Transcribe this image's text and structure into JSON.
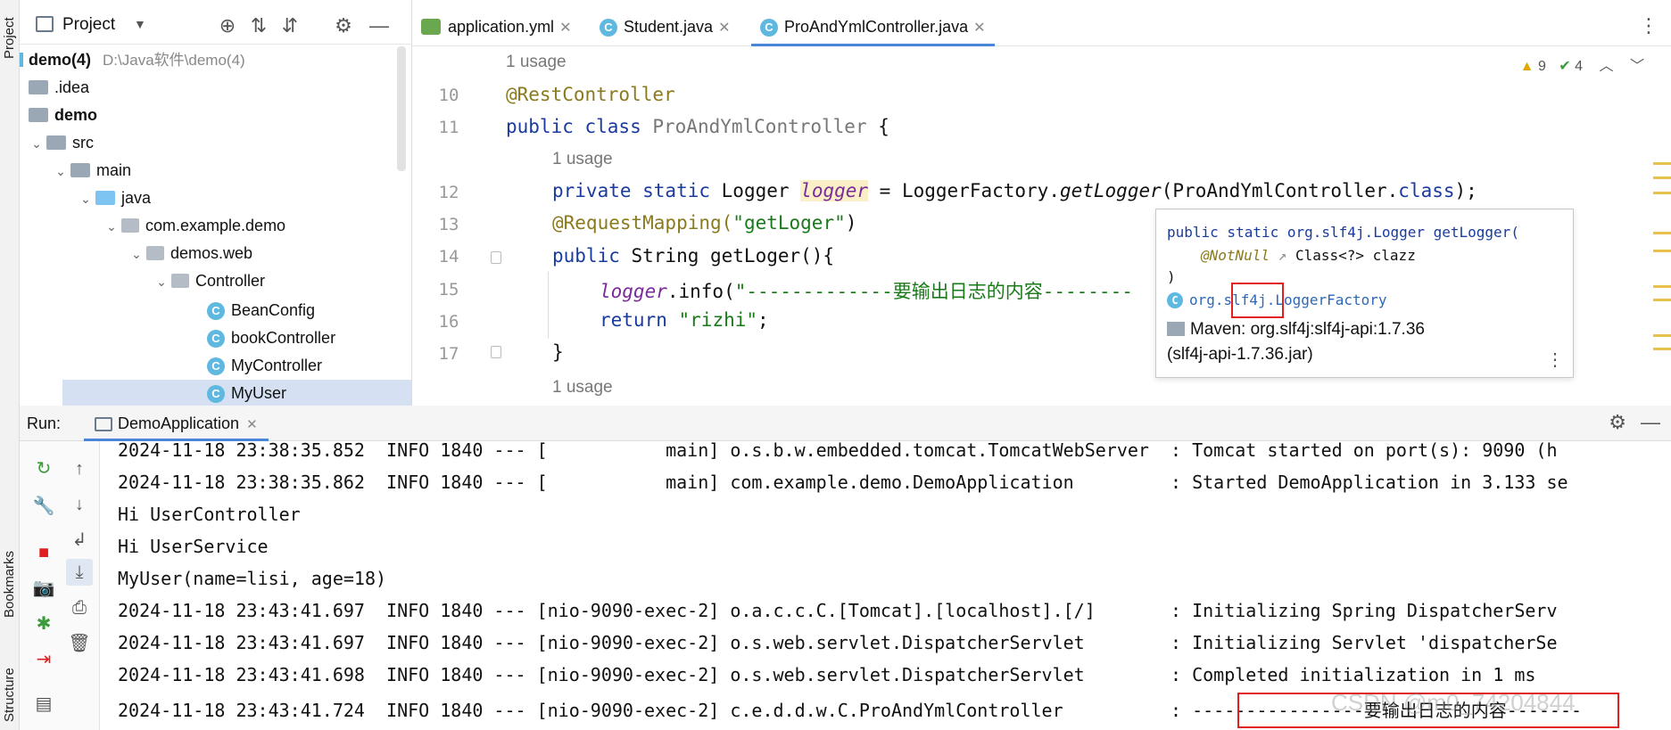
{
  "left_strip": {
    "project_label": "Project",
    "bookmarks_label": "Bookmarks",
    "structure_label": "Structure"
  },
  "project": {
    "title": "Project",
    "icons": [
      "locate-icon",
      "expand-all-icon",
      "collapse-all-icon",
      "gear-icon",
      "minimize-icon"
    ],
    "root_name": "demo(4)",
    "root_path": "D:\\Java软件\\demo(4)",
    "tree": [
      {
        "label": ".idea",
        "kind": "folder"
      },
      {
        "label": "demo",
        "kind": "folder-bold"
      },
      {
        "label": "src",
        "kind": "folder"
      },
      {
        "label": "main",
        "kind": "folder"
      },
      {
        "label": "java",
        "kind": "folder-blue"
      },
      {
        "label": "com.example.demo",
        "kind": "package"
      },
      {
        "label": "demos.web",
        "kind": "package"
      },
      {
        "label": "Controller",
        "kind": "package"
      },
      {
        "label": "BeanConfig",
        "kind": "class"
      },
      {
        "label": "bookController",
        "kind": "class"
      },
      {
        "label": "MyController",
        "kind": "class"
      },
      {
        "label": "MyUser",
        "kind": "class"
      }
    ]
  },
  "tabs": [
    {
      "label": "application.yml",
      "icon": "yml-icon"
    },
    {
      "label": "Student.java",
      "icon": "class-icon"
    },
    {
      "label": "ProAndYmlController.java",
      "icon": "class-icon",
      "active": true
    }
  ],
  "inspection": {
    "warnings": "9",
    "ok": "4"
  },
  "editor": {
    "usage_text": "1 usage",
    "line_numbers": [
      "10",
      "11",
      "12",
      "13",
      "14",
      "15",
      "16",
      "17"
    ],
    "l10": "@RestController",
    "l11_kw": "public class",
    "l11_name": "ProAndYmlController",
    "l11_end": " {",
    "l12_kw": "private static",
    "l12_type": " Logger ",
    "l12_var": "logger",
    "l12_mid": " = LoggerFactory.",
    "l12_method": "getLogger",
    "l12_arg": "(ProAndYmlController.",
    "l12_class": "class",
    "l12_end": ");",
    "l13_ann": "@RequestMapping(",
    "l13_str": "\"getLoger\"",
    "l13_end": ")",
    "l14_kw": "public",
    "l14_rest": " String getLoger(){",
    "l15_var": "logger",
    "l15_mid": ".info(",
    "l15_str": "\"-------------要输出日志的内容--------",
    "l16_kw": "return",
    "l16_str": "\"rizhi\"",
    "l16_end": ";",
    "l17": "}"
  },
  "popup": {
    "sig1": "public static org.slf4j.Logger getLogger(",
    "sig2": "@NotNull",
    "sig2b": " Class<?> clazz",
    "sig3": ")",
    "pkg_pre": "org.",
    "pkg_mid": "slf4j",
    "pkg_post": ".LoggerFactory",
    "maven1": "Maven: org.slf4j:slf4j-api:1.7.36",
    "maven2": "(slf4j-api-1.7.36.jar)"
  },
  "run": {
    "label": "Run:",
    "tab_label": "DemoApplication",
    "lines": [
      "2024-11-18 23:38:35.852  INFO 1840 --- [           main] o.s.b.w.embedded.tomcat.TomcatWebServer  : Tomcat started on port(s): 9090 (h",
      "2024-11-18 23:38:35.862  INFO 1840 --- [           main] com.example.demo.DemoApplication         : Started DemoApplication in 3.133 se",
      "Hi UserController",
      "Hi UserService",
      "MyUser(name=lisi, age=18)",
      "2024-11-18 23:43:41.697  INFO 1840 --- [nio-9090-exec-2] o.a.c.c.C.[Tomcat].[localhost].[/]       : Initializing Spring DispatcherServ",
      "2024-11-18 23:43:41.697  INFO 1840 --- [nio-9090-exec-2] o.s.web.servlet.DispatcherServlet        : Initializing Servlet 'dispatcherSe",
      "2024-11-18 23:43:41.698  INFO 1840 --- [nio-9090-exec-2] o.s.web.servlet.DispatcherServlet        : Completed initialization in 1 ms",
      "2024-11-18 23:43:41.724  INFO 1840 --- [nio-9090-exec-2] c.e.d.d.w.C.ProAndYmlController          : ----------------要输出日志的内容-------"
    ]
  },
  "watermark": "CSDN @m0_74204844"
}
